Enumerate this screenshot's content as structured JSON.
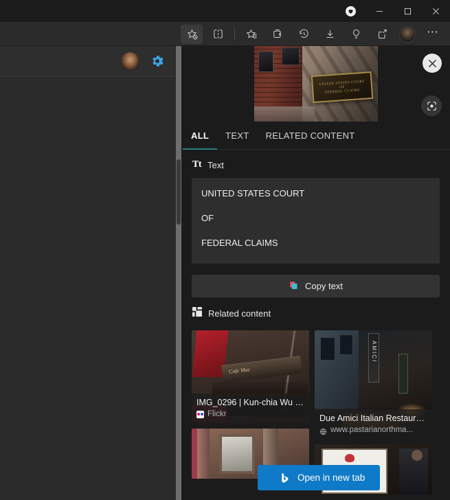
{
  "window": {
    "controls": [
      {
        "name": "minimize",
        "glyph": "minimize-icon"
      },
      {
        "name": "maximize",
        "glyph": "maximize-icon"
      },
      {
        "name": "close",
        "glyph": "close-icon"
      }
    ],
    "rewards_icon": "rewards-heart-icon"
  },
  "toolbar": {
    "icons": [
      {
        "name": "add-favorite-icon",
        "label": "Add this page to favorites",
        "active": true
      },
      {
        "name": "split-screen-icon",
        "label": "Split screen"
      },
      {
        "name": "favorites-icon",
        "label": "Favorites"
      },
      {
        "name": "collections-icon",
        "label": "Collections"
      },
      {
        "name": "history-icon",
        "label": "History"
      },
      {
        "name": "downloads-icon",
        "label": "Downloads"
      },
      {
        "name": "tips-icon",
        "label": "Browser essentials"
      },
      {
        "name": "share-icon",
        "label": "Share"
      }
    ],
    "profile_label": "Profile",
    "more_label": "Settings and more"
  },
  "page": {
    "avatar_label": "Account avatar",
    "settings_label": "Settings"
  },
  "visual_search": {
    "hero": {
      "image_alt": "Courthouse building facade with plaque",
      "plaque_lines": [
        "UNITED STATES COURT",
        "OF",
        "FEDERAL CLAIMS"
      ],
      "close_label": "Close",
      "visual_search_label": "Visual search"
    },
    "tabs": [
      {
        "id": "all",
        "label": "ALL",
        "selected": true
      },
      {
        "id": "text",
        "label": "TEXT",
        "selected": false
      },
      {
        "id": "related",
        "label": "RELATED CONTENT",
        "selected": false
      }
    ],
    "accent_color": "#2f7d82",
    "text_section": {
      "icon": "text-tt-icon",
      "heading": "Text",
      "lines": [
        "UNITED STATES COURT",
        "OF",
        "FEDERAL CLAIMS"
      ],
      "copy_button": {
        "label": "Copy text",
        "icon": "copy-icon"
      }
    },
    "related_section": {
      "icon": "related-content-grid-icon",
      "heading": "Related content",
      "cards": [
        {
          "title": "IMG_0296 | Kun-chia Wu | ...",
          "source": "Flickr",
          "source_icon": "flickr-favicon",
          "art": "t-a"
        },
        {
          "title": "Due Amici Italian Restaura...",
          "source": "www.pastarianorthma...",
          "source_icon": "globe-favicon",
          "art": "t-b"
        },
        {
          "title": "",
          "source": "",
          "source_icon": "",
          "art": "t-c"
        },
        {
          "title": "",
          "source": "",
          "source_icon": "",
          "art": "t-d"
        }
      ]
    },
    "tooltip": {
      "label": "Open in new tab",
      "icon": "bing-icon",
      "color": "#0f7ac7"
    }
  }
}
